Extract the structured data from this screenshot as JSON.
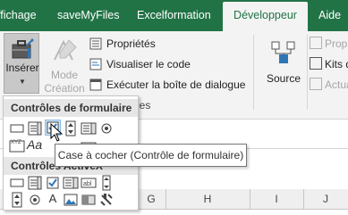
{
  "tabs": [
    {
      "label": "ffichage",
      "active": false
    },
    {
      "label": "saveMyFiles",
      "active": false
    },
    {
      "label": "Excelformation",
      "active": false
    },
    {
      "label": "Développeur",
      "active": true
    },
    {
      "label": "Aide",
      "active": false
    }
  ],
  "ribbon": {
    "insert_label": "Insérer",
    "design_mode_label": "Mode Création",
    "properties_label": "Propriétés",
    "view_code_label": "Visualiser le code",
    "run_dialog_label": "Exécuter la boîte de dialogue",
    "group_label_partial": "les",
    "source_label": "Source",
    "right_items": [
      "Propriét",
      "Kits d'",
      "Actua"
    ]
  },
  "dropdown": {
    "form_controls_header": "Contrôles de formulaire",
    "activex_header": "Contrôles ActiveX"
  },
  "tooltip": "Case à cocher (Contrôle de formulaire)",
  "columns": [
    "G",
    "H",
    "I",
    "J"
  ],
  "colors": {
    "excel_green": "#217346",
    "ribbon_bg": "#f3f3f3",
    "highlight": "#cce4f7"
  }
}
